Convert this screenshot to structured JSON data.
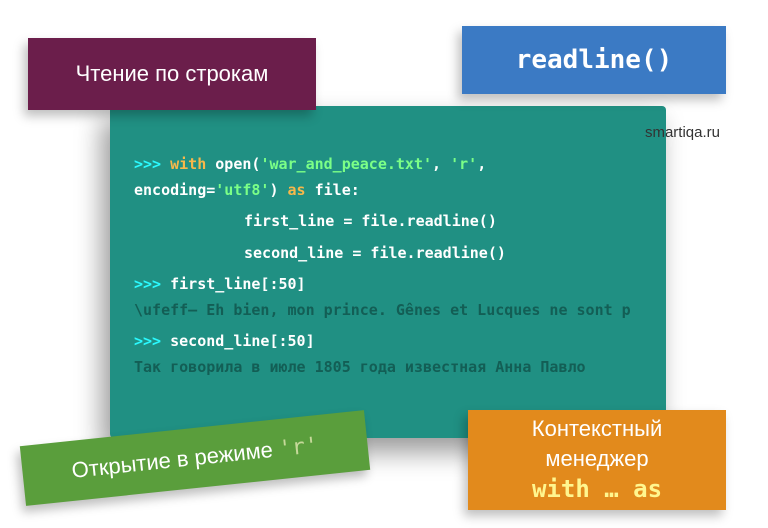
{
  "labels": {
    "purple": "Чтение по строкам",
    "blue": "readline()",
    "green_text": "Открытие в режиме ",
    "green_mode": "'r'",
    "orange_line1": "Контекстный",
    "orange_line2": "менеджер",
    "orange_line3": "with … as",
    "attribution": "smartiqa.ru"
  },
  "code": {
    "prompt": ">>> ",
    "l1_kw_with": "with",
    "l1_open": " open(",
    "l1_str1": "'war_and_peace.txt'",
    "l1_comma1": ", ",
    "l1_str2": "'r'",
    "l1_comma2": ",",
    "l2_enc": "encoding=",
    "l2_str": "'utf8'",
    "l2_close": ") ",
    "l2_kw_as": "as",
    "l2_var": " file:",
    "l3": "first_line = file.readline()",
    "l4": "second_line = file.readline()",
    "l5": "first_line[:50]",
    "out1": "\\ufeff— Eh bien, mon prince. Gênes et Lucques ne sont p",
    "l7": "second_line[:50]",
    "out2": "Так говорила в июле 1805 года известная Анна Павло"
  }
}
